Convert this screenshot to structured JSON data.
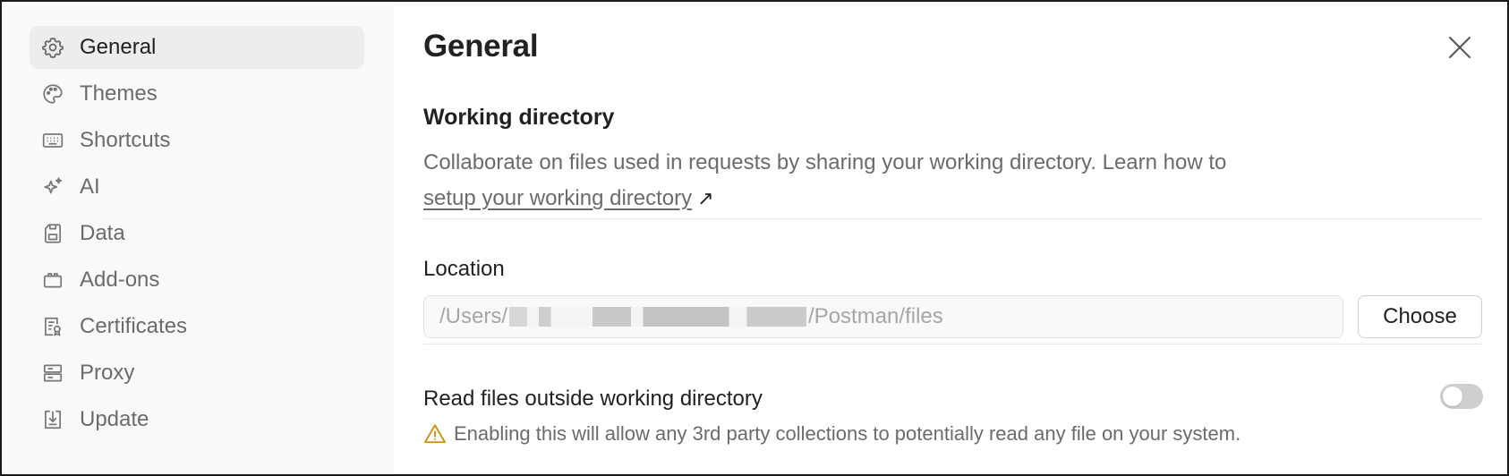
{
  "sidebar": {
    "items": [
      {
        "label": "General",
        "icon": "gear-icon",
        "active": true
      },
      {
        "label": "Themes",
        "icon": "palette-icon",
        "active": false
      },
      {
        "label": "Shortcuts",
        "icon": "keyboard-icon",
        "active": false
      },
      {
        "label": "AI",
        "icon": "sparkle-icon",
        "active": false
      },
      {
        "label": "Data",
        "icon": "save-icon",
        "active": false
      },
      {
        "label": "Add-ons",
        "icon": "puzzle-icon",
        "active": false
      },
      {
        "label": "Certificates",
        "icon": "certificate-icon",
        "active": false
      },
      {
        "label": "Proxy",
        "icon": "server-icon",
        "active": false
      },
      {
        "label": "Update",
        "icon": "download-icon",
        "active": false
      }
    ]
  },
  "main": {
    "title": "General",
    "close_icon": "close-icon",
    "working_directory": {
      "title": "Working directory",
      "description_prefix": "Collaborate on files used in requests by sharing your working directory. Learn how to",
      "link_text": "setup your working directory",
      "link_icon": "external-link-arrow-icon",
      "location_label": "Location",
      "path_prefix": "/Users/",
      "path_suffix": "/Postman/files",
      "choose_label": "Choose"
    },
    "read_outside": {
      "label": "Read files outside working directory",
      "enabled": false,
      "warning_icon": "warning-icon",
      "warning_text": "Enabling this will allow any 3rd party collections to potentially read any file on your system."
    }
  },
  "colors": {
    "sidebar_bg": "#f9f9f9",
    "active_item_bg": "#ededed",
    "text_primary": "#212121",
    "text_secondary": "#6b6b6b",
    "warning": "#c8951a",
    "toggle_off": "#cfcfcf"
  }
}
